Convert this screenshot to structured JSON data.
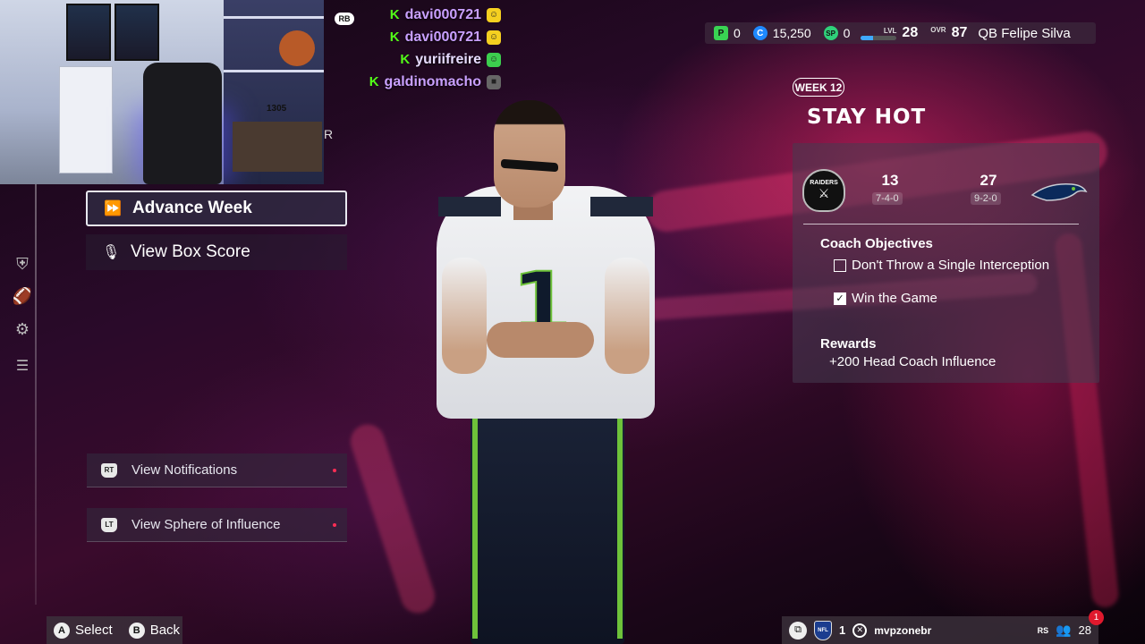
{
  "stream_chat": [
    {
      "badge": "K",
      "user": "davi000721",
      "emote": "yellow"
    },
    {
      "badge": "K",
      "user": "davi000721",
      "emote": "yellow"
    },
    {
      "badge": "K",
      "user": "yuriifreire",
      "emote": "green"
    },
    {
      "badge": "K",
      "user": "galdinomacho",
      "emote": "grey"
    }
  ],
  "rb_badge": "RB",
  "webcam": {
    "cam_label": "1305",
    "stray_letter": "R"
  },
  "currency_bar": {
    "p_icon": "P",
    "p_value": "0",
    "c_icon": "C",
    "c_value": "15,250",
    "sp_icon": "SP",
    "sp_value": "0",
    "lvl_label": "LVL",
    "lvl_value": "28",
    "xp_progress": 0.35,
    "ovr_label": "OVR",
    "ovr_value": "87",
    "player": "QB Felipe Silva"
  },
  "menu": {
    "advance_week": "Advance Week",
    "view_box_score": "View Box Score",
    "view_notifications": "View Notifications",
    "view_notifications_trigger": "RT",
    "view_sphere": "View Sphere of Influence",
    "view_sphere_trigger": "LT"
  },
  "jersey": {
    "number": "1"
  },
  "week_panel": {
    "week_badge": "WEEK 12",
    "title": "STAY HOT",
    "home_team_logo": "RAIDERS",
    "home_score": "13",
    "home_record": "7-4-0",
    "away_score": "27",
    "away_record": "9-2-0",
    "objectives_title": "Coach Objectives",
    "objectives": [
      {
        "label": "Don't Throw a Single Interception",
        "checked": false
      },
      {
        "label": "Win the Game",
        "checked": true
      }
    ],
    "rewards_title": "Rewards",
    "reward": "+200 Head Coach Influence"
  },
  "bottom_left": {
    "a_btn": "A",
    "select": "Select",
    "b_btn": "B",
    "back": "Back"
  },
  "bottom_right": {
    "nfl_logo": "NFL",
    "count": "1",
    "gamertag": "mvpzonebr",
    "rs_label": "RS",
    "friends": "28",
    "notification_count": "1"
  },
  "colors": {
    "accent_green": "#53fc18",
    "chat_user": "#c9a0ff",
    "notif_red": "#e0192d"
  }
}
